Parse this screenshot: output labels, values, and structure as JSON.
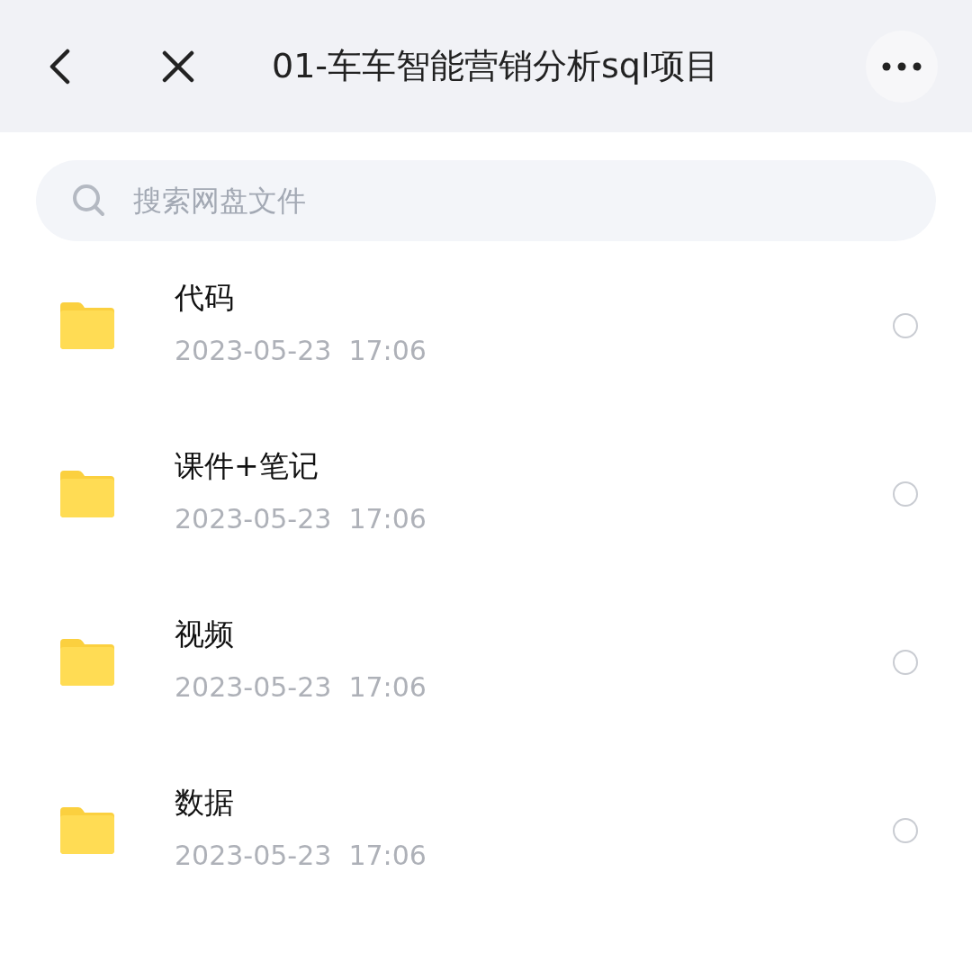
{
  "header": {
    "title": "01-车车智能营销分析sql项目"
  },
  "search": {
    "placeholder": "搜索网盘文件"
  },
  "files": [
    {
      "name": "代码",
      "modified": "2023-05-23  17:06",
      "selected": false
    },
    {
      "name": "课件+笔记",
      "modified": "2023-05-23  17:06",
      "selected": false
    },
    {
      "name": "视频",
      "modified": "2023-05-23  17:06",
      "selected": false
    },
    {
      "name": "数据",
      "modified": "2023-05-23  17:06",
      "selected": false
    }
  ]
}
